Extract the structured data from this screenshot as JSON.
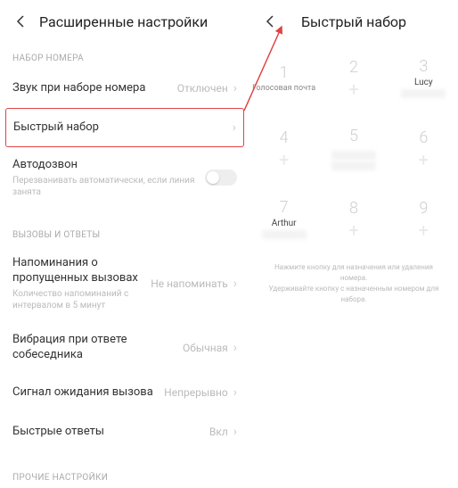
{
  "left": {
    "title": "Расширенные настройки",
    "section_dial": "НАБОР НОМЕРА",
    "rows": {
      "sound": {
        "title": "Звук при наборе номера",
        "value": "Отключен"
      },
      "speed_dial": {
        "title": "Быстрый набор"
      },
      "autoredial": {
        "title": "Автодозвон",
        "sub": "Перезванивать автоматически, если линия занята"
      }
    },
    "section_calls": "ВЫЗОВЫ И ОТВЕТЫ",
    "rows2": {
      "missed": {
        "title": "Напоминания о пропущенных вызовах",
        "sub": "Количество напоминаний с интервалом в 5 минут",
        "value": "Не напоминать"
      },
      "vibration": {
        "title": "Вибрация при ответе собеседника",
        "value": "Обычная"
      },
      "waiting": {
        "title": "Сигнал ожидания вызова",
        "value": "Непрерывно"
      },
      "quick_replies": {
        "title": "Быстрые ответы",
        "value": "Вкл"
      }
    },
    "section_other": "ПРОЧИЕ НАСТРОЙКИ"
  },
  "right": {
    "title": "Быстрый набор",
    "cells": [
      {
        "num": "1",
        "label": "Голосовая почта"
      },
      {
        "num": "2"
      },
      {
        "num": "3",
        "contact": "Lucy"
      },
      {
        "num": "4"
      },
      {
        "num": "5"
      },
      {
        "num": "6"
      },
      {
        "num": "7",
        "contact": "Arthur"
      },
      {
        "num": "8"
      },
      {
        "num": "9"
      }
    ],
    "hint1": "Нажмите кнопку для назначения или удаления номера.",
    "hint2": "Удерживайте кнопку с назначенным номером для набора."
  }
}
